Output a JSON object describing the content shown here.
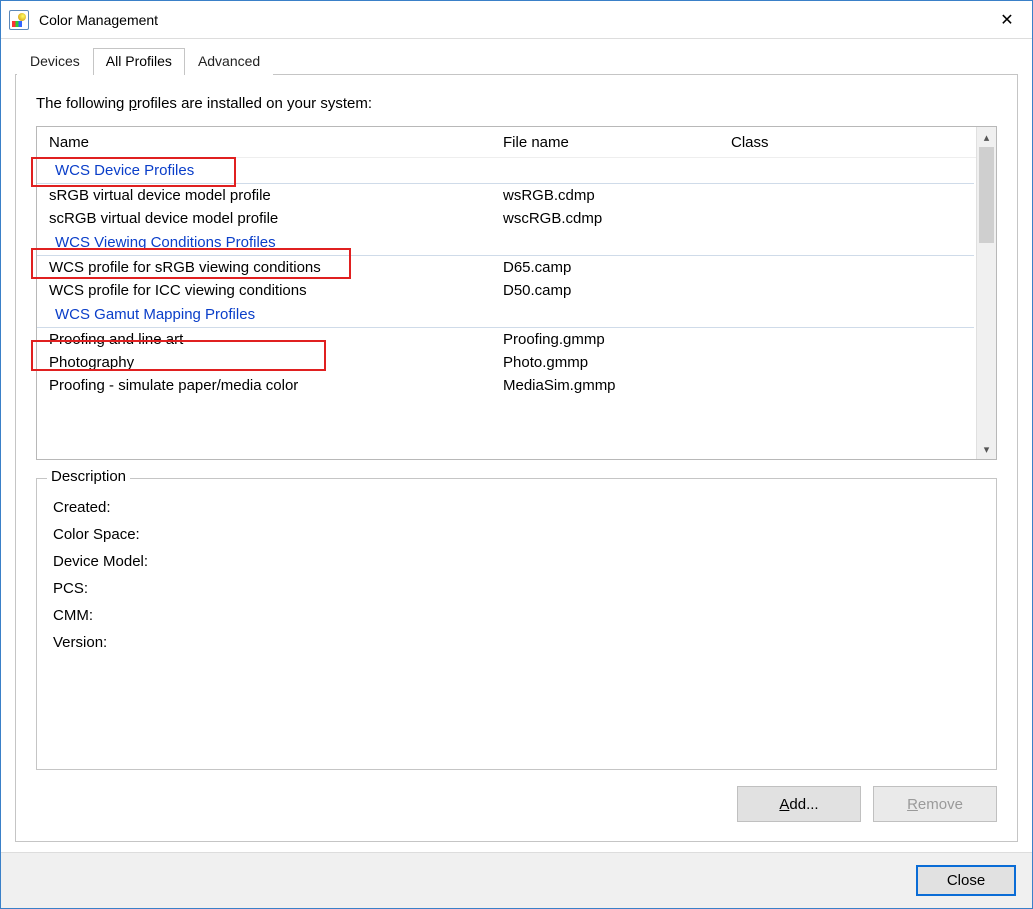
{
  "window": {
    "title": "Color Management"
  },
  "tabs": [
    {
      "label": "Devices",
      "active": false
    },
    {
      "label": "All Profiles",
      "active": true
    },
    {
      "label": "Advanced",
      "active": false
    }
  ],
  "intro_html": "The following profiles are installed on your system:",
  "columns": {
    "name": "Name",
    "file": "File name",
    "class": "Class"
  },
  "groups": [
    {
      "label": "WCS Device Profiles",
      "items": [
        {
          "name": "sRGB virtual device model profile",
          "file": "wsRGB.cdmp"
        },
        {
          "name": "scRGB virtual device model profile",
          "file": "wscRGB.cdmp"
        }
      ]
    },
    {
      "label": "WCS Viewing Conditions Profiles",
      "items": [
        {
          "name": "WCS profile for sRGB viewing conditions",
          "file": "D65.camp"
        },
        {
          "name": "WCS profile for ICC viewing conditions",
          "file": "D50.camp"
        }
      ]
    },
    {
      "label": "WCS Gamut Mapping Profiles",
      "items": [
        {
          "name": "Proofing and line art",
          "file": "Proofing.gmmp"
        },
        {
          "name": "Photography",
          "file": "Photo.gmmp"
        },
        {
          "name": "Proofing - simulate paper/media color",
          "file": "MediaSim.gmmp"
        }
      ]
    }
  ],
  "description": {
    "legend": "Description",
    "fields": [
      "Created:",
      "Color Space:",
      "Device Model:",
      "PCS:",
      "CMM:",
      "Version:"
    ]
  },
  "buttons": {
    "add": "dd...",
    "remove": "emove",
    "close": "Close"
  }
}
